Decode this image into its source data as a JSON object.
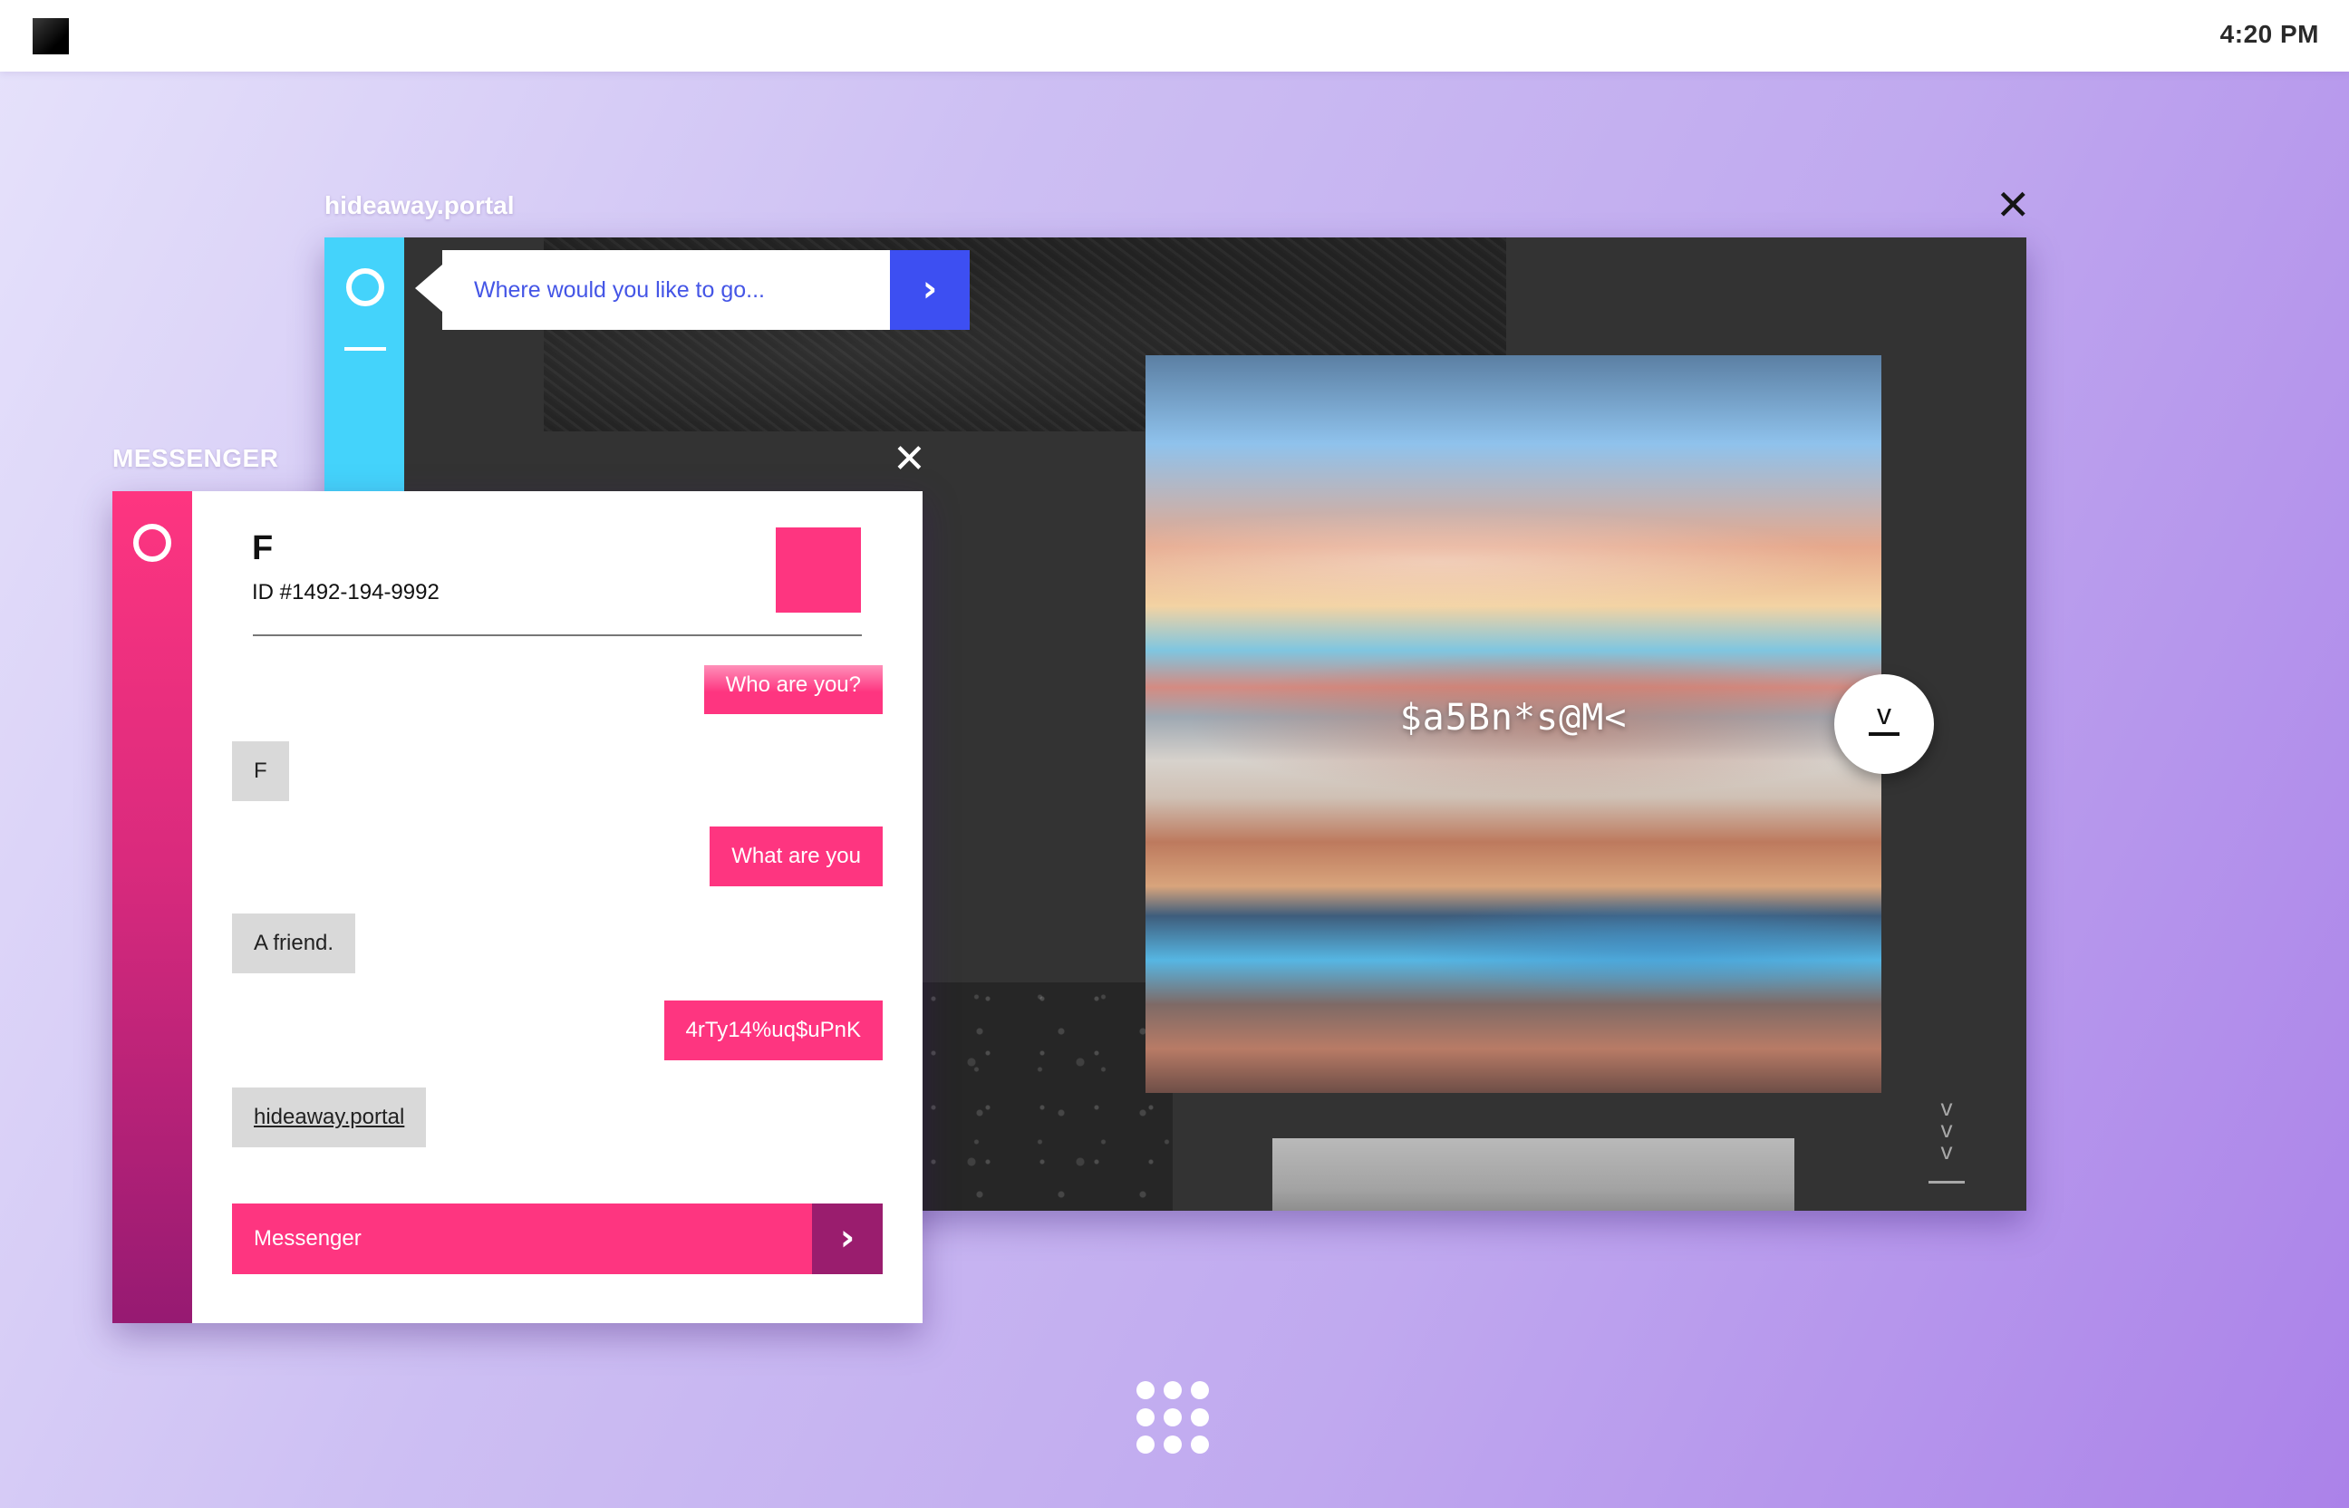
{
  "topbar": {
    "clock": "4:20 PM"
  },
  "portal": {
    "title": "hideaway.portal",
    "close_glyph": "✕",
    "search": {
      "placeholder": "Where would you like to go...",
      "go_glyph": "›"
    },
    "hero": {
      "glitch_text": "$a5Bn*s@M<"
    },
    "fab_glyph": "v",
    "scroll_glyph": "v"
  },
  "messenger": {
    "title": "MESSENGER",
    "close_glyph": "✕",
    "contact": {
      "name": "F",
      "id": "ID #1492-194-9992"
    },
    "messages": [
      {
        "from": "me",
        "text": "Who are you?"
      },
      {
        "from": "them",
        "text": "F"
      },
      {
        "from": "me",
        "text": "What are you"
      },
      {
        "from": "them",
        "text": "A friend."
      },
      {
        "from": "me",
        "text": "4rTy14%uq$uPnK"
      },
      {
        "from": "them",
        "text": "hideaway.portal",
        "link": true
      }
    ],
    "composer": {
      "placeholder": "Messenger",
      "send_glyph": "›"
    }
  },
  "colors": {
    "portal_rail": "#44d3fb",
    "search_button": "#3d4ff2",
    "messenger_accent": "#fe3580",
    "messenger_send": "#9a1d6e",
    "incoming_bubble": "#d9d9d9"
  },
  "icons": [
    "app-logo-icon",
    "close-icon",
    "circle-icon",
    "arrow-right-icon",
    "chevron-down-icon",
    "app-grid-icon"
  ]
}
